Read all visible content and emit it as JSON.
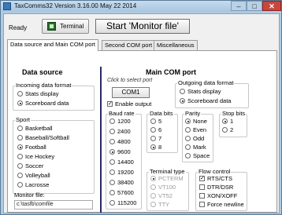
{
  "window": {
    "title": "TaxComms32 Version 3.16.00 May 22 2014",
    "minimize_symbol": "–",
    "maximize_symbol": "□",
    "close_symbol": "✕"
  },
  "toolbar": {
    "status": "Ready",
    "terminal_label": "Terminal",
    "start_label": "Start 'Monitor file'"
  },
  "tabs": [
    {
      "label": "Data source and Main COM port",
      "active": true
    },
    {
      "label": "Second COM port",
      "active": false
    },
    {
      "label": "Miscellaneous",
      "active": false
    }
  ],
  "data_source": {
    "heading": "Data source",
    "incoming_format": {
      "title": "Incoming data format",
      "options": [
        "Stats display",
        "Scoreboard data"
      ],
      "selected": "Scoreboard data"
    },
    "sport": {
      "title": "Sport",
      "options": [
        "Basketball",
        "Baseball/Softball",
        "Football",
        "Ice Hockey",
        "Soccer",
        "Volleyball",
        "Lacrosse"
      ],
      "selected": "Football"
    },
    "monitor_file_label": "Monitor file:",
    "monitor_file_value": "c:\\tasfb\\comfile"
  },
  "main_com": {
    "heading": "Main COM port",
    "hint": "Click to select port",
    "port_button": "COM1",
    "enable_output_label": "Enable output",
    "enable_output_checked": true,
    "outgoing_format": {
      "title": "Outgoing data format",
      "options": [
        "Stats display",
        "Scoreboard data"
      ],
      "selected": "Scoreboard data"
    },
    "baud_rate": {
      "title": "Baud rate",
      "options": [
        "1200",
        "2400",
        "4800",
        "9600",
        "14400",
        "19200",
        "38400",
        "57600",
        "115200"
      ],
      "selected": "9600"
    },
    "data_bits": {
      "title": "Data bits",
      "options": [
        "5",
        "6",
        "7",
        "8"
      ],
      "selected": "8"
    },
    "parity": {
      "title": "Parity",
      "options": [
        "None",
        "Even",
        "Odd",
        "Mark",
        "Space"
      ],
      "selected": "None"
    },
    "stop_bits": {
      "title": "Stop bits",
      "options": [
        "1",
        "2"
      ],
      "selected": "1"
    },
    "terminal_type": {
      "title": "Terminal type",
      "options": [
        "PCTERM",
        "VT100",
        "VT52",
        "TTY"
      ],
      "selected": "PCTERM",
      "disabled": true
    },
    "flow_control": {
      "title": "Flow control",
      "options": [
        {
          "label": "RTS/CTS",
          "checked": true
        },
        {
          "label": "DTR/DSR",
          "checked": false
        },
        {
          "label": "XON/XOFF",
          "checked": false
        },
        {
          "label": "Force newline",
          "checked": false
        }
      ]
    }
  },
  "colors": {
    "titlebar": "#a9c6df",
    "close": "#c9463d",
    "separator": "#2a2a6a"
  }
}
